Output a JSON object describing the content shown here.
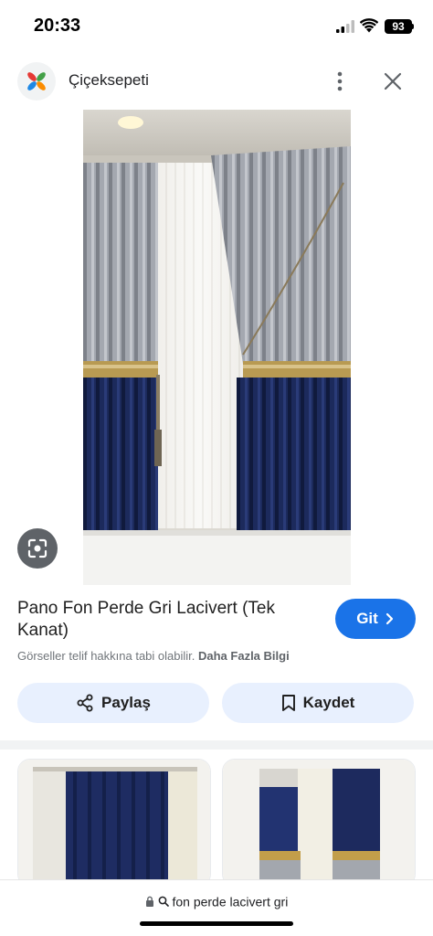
{
  "status_bar": {
    "time": "20:33",
    "battery": "93"
  },
  "header": {
    "site_name": "Çiçeksepeti"
  },
  "result": {
    "title": "Pano Fon Perde Gri Lacivert (Tek Kanat)",
    "visit_label": "Git",
    "copyright_notice": "Görseller telif hakkına tabi olabilir.",
    "more_info_link": "Daha Fazla Bilgi"
  },
  "actions": {
    "share_label": "Paylaş",
    "save_label": "Kaydet"
  },
  "url_bar": {
    "query": "fon perde lacivert gri"
  },
  "colors": {
    "accent": "#1a73e8",
    "action_bg": "#e8f0fe",
    "navy": "#1c2a5c",
    "grey_curtain": "#9a9ea6"
  },
  "icons": [
    "cellular-signal-icon",
    "wifi-icon",
    "battery-icon",
    "site-logo-icon",
    "more-vertical-icon",
    "close-icon",
    "lens-icon",
    "chevron-right-icon",
    "share-icon",
    "bookmark-icon",
    "lock-icon",
    "search-icon"
  ]
}
